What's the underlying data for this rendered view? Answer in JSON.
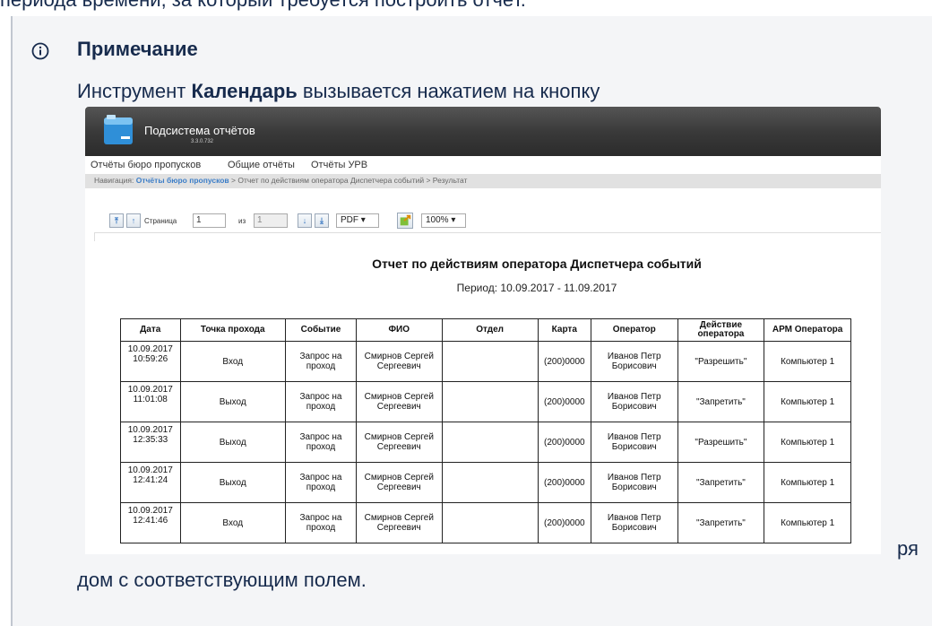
{
  "top_fragment": "периода времени, за который требуется построить отчёт.",
  "note": {
    "title": "Примечание",
    "text_before": "Инструмент ",
    "text_bold": "Календарь",
    "text_after": " вызывается нажатием на кнопку",
    "tail_right": "ря",
    "tail": "дом с соответствующим полем."
  },
  "app": {
    "title": "Подсистема отчётов",
    "version": "3.3.0.732",
    "menu": [
      "Отчёты бюро пропусков",
      "Общие отчёты",
      "Отчёты УРВ"
    ],
    "breadcrumb_prefix": "Навигация: ",
    "breadcrumb_link": "Отчёты бюро пропусков",
    "breadcrumb_rest": " > Отчет по действиям оператора Диспетчера событий > Результат",
    "toolbar": {
      "page_label": "Страница",
      "page_value": "1",
      "of_label": "из",
      "total_pages": "1",
      "format": "PDF",
      "zoom": "100%"
    }
  },
  "report": {
    "title": "Отчет по действиям оператора Диспетчера событий",
    "period": "Период: 10.09.2017 - 11.09.2017",
    "headers": [
      "Дата",
      "Точка прохода",
      "Событие",
      "ФИО",
      "Отдел",
      "Карта",
      "Оператор",
      "Действие оператора",
      "АРМ Оператора"
    ],
    "rows": [
      {
        "date": "10.09.2017",
        "time": "10:59:26",
        "point": "Вход",
        "event": "Запрос на проход",
        "fio": "Смирнов Сергей Сергеевич",
        "dept": "",
        "card": "(200)0000",
        "operator": "Иванов Петр Борисович",
        "action": "\"Разрешить\"",
        "arm": "Компьютер 1"
      },
      {
        "date": "10.09.2017",
        "time": "11:01:08",
        "point": "Выход",
        "event": "Запрос на проход",
        "fio": "Смирнов Сергей Сергеевич",
        "dept": "",
        "card": "(200)0000",
        "operator": "Иванов Петр Борисович",
        "action": "\"Запретить\"",
        "arm": "Компьютер 1"
      },
      {
        "date": "10.09.2017",
        "time": "12:35:33",
        "point": "Выход",
        "event": "Запрос на проход",
        "fio": "Смирнов Сергей Сергеевич",
        "dept": "",
        "card": "(200)0000",
        "operator": "Иванов Петр Борисович",
        "action": "\"Разрешить\"",
        "arm": "Компьютер 1"
      },
      {
        "date": "10.09.2017",
        "time": "12:41:24",
        "point": "Выход",
        "event": "Запрос на проход",
        "fio": "Смирнов Сергей Сергеевич",
        "dept": "",
        "card": "(200)0000",
        "operator": "Иванов Петр Борисович",
        "action": "\"Запретить\"",
        "arm": "Компьютер 1"
      },
      {
        "date": "10.09.2017",
        "time": "12:41:46",
        "point": "Вход",
        "event": "Запрос на проход",
        "fio": "Смирнов Сергей Сергеевич",
        "dept": "",
        "card": "(200)0000",
        "operator": "Иванов Петр Борисович",
        "action": "\"Запретить\"",
        "arm": "Компьютер 1"
      }
    ]
  },
  "colors": {
    "note_background": "#f4f5f7",
    "note_border": "#c1c7d0",
    "breadcrumb_link": "#3c7ec8",
    "header_dark": "#3a3a3a"
  },
  "icons": [
    "info-icon",
    "app-logo-icon",
    "first-page-icon",
    "prev-page-icon",
    "next-page-icon",
    "last-page-icon",
    "export-icon"
  ]
}
